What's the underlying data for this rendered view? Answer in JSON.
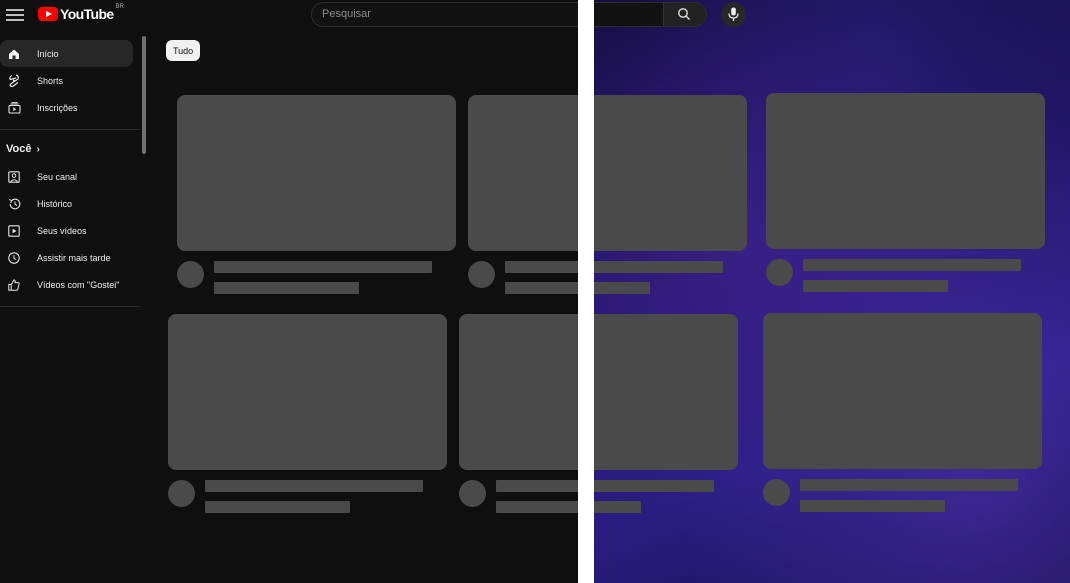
{
  "header": {
    "logo_text": "YouTube",
    "logo_region": "BR",
    "search_placeholder": "Pesquisar"
  },
  "sidebar": {
    "items": [
      {
        "label": "Início",
        "icon": "home-icon",
        "active": true
      },
      {
        "label": "Shorts",
        "icon": "shorts-icon",
        "active": false
      },
      {
        "label": "Inscrições",
        "icon": "subscriptions-icon",
        "active": false
      }
    ],
    "section_title": "Você",
    "section_items": [
      {
        "label": "Seu canal",
        "icon": "channel-icon"
      },
      {
        "label": "Histórico",
        "icon": "history-icon"
      },
      {
        "label": "Seus vídeos",
        "icon": "your-videos-icon"
      },
      {
        "label": "Assistir mais tarde",
        "icon": "watch-later-icon"
      },
      {
        "label": "Vídeos com \"Gostei\"",
        "icon": "liked-icon"
      }
    ]
  },
  "chips": [
    "Tudo"
  ],
  "colors": {
    "background": "#0f0f0f",
    "placeholder": "#4a4a4a",
    "brand": "#ff0000",
    "divider": "#ffffff"
  }
}
